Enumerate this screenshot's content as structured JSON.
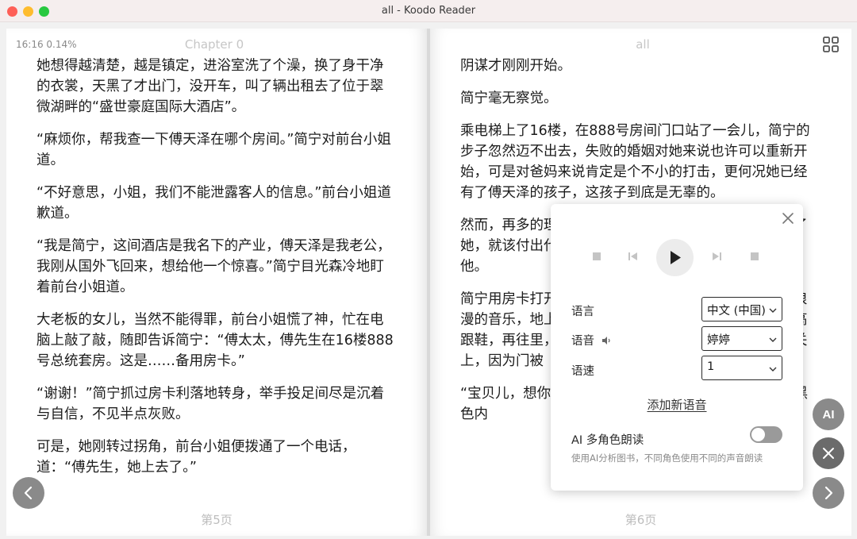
{
  "window": {
    "title": "all - Koodo Reader"
  },
  "left_page": {
    "status": "16:16 0.14%",
    "header": "Chapter 0",
    "paragraphs": [
      "她想得越清楚，越是镇定，进浴室洗了个澡，换了身干净的衣裳，天黑了才出门，没开车，叫了辆出租去了位于翠微湖畔的“盛世豪庭国际大酒店”。",
      "“麻烦你，帮我查一下傅天泽在哪个房间。”简宁对前台小姐道。",
      "“不好意思，小姐，我们不能泄露客人的信息。”前台小姐道歉道。",
      "“我是简宁，这间酒店是我名下的产业，傅天泽是我老公，我刚从国外飞回来，想给他一个惊喜。”简宁目光森冷地盯着前台小姐道。",
      "大老板的女儿，当然不能得罪，前台小姐慌了神，忙在电脑上敲了敲，随即告诉简宁：“傅太太，傅先生在16楼888号总统套房。这是……备用房卡。”",
      "“谢谢！”简宁抓过房卡利落地转身，举手投足间尽是沉着与自信，不见半点灰败。",
      "可是，她刚转过拐角，前台小姐便拨通了一个电话，道：“傅先生，她上去了。”"
    ],
    "footer": "第5页"
  },
  "right_page": {
    "header": "all",
    "paragraphs": [
      "阴谋才刚刚开始。",
      "简宁毫无察觉。",
      "乘电梯上了16楼，在888号房间门口站了一会儿，简宁的步子忽然迈不出去，失败的婚姻对她来说也许可以重新开始，可是对爸妈来说肯定是个不小的打击，更何况她已经有了傅天泽的孩子，这孩子到底是无辜的。",
      "然而，再多的理由也不能成为原谅的借口，傅天泽欺骗了她，就该付出代价，就算他有千般理由，法律不会放过他。",
      "简宁用房卡打开了房门，走了进去。客厅里放着悠扬而浪漫的音乐，地上凌乱地扔着衣服，沙发旁有一只女人的高跟鞋，再往里，是男人的衬衫、裤子……卧室的门没有关上，因为门被",
      "“宝贝儿，想你了……”她听到一个男人说，我最喜欢的黑色内"
    ],
    "footer": "第6页"
  },
  "tts_panel": {
    "language_label": "语言",
    "language_value": "中文 (中国)",
    "voice_label": "语音",
    "voice_value": "婷婷",
    "speed_label": "语速",
    "speed_value": "1",
    "add_voice": "添加新语音",
    "ai_title": "AI 多角色朗读",
    "ai_desc": "使用AI分析图书，不同角色使用不同的声音朗读",
    "ai_enabled": false
  },
  "side_buttons": {
    "ai_label": "AI"
  },
  "icons": [
    "grid-icon",
    "close-icon",
    "stop-icon",
    "prev-track-icon",
    "play-icon",
    "next-track-icon",
    "speaker-icon",
    "chevron-down-icon",
    "chevron-left-icon",
    "chevron-right-icon"
  ]
}
